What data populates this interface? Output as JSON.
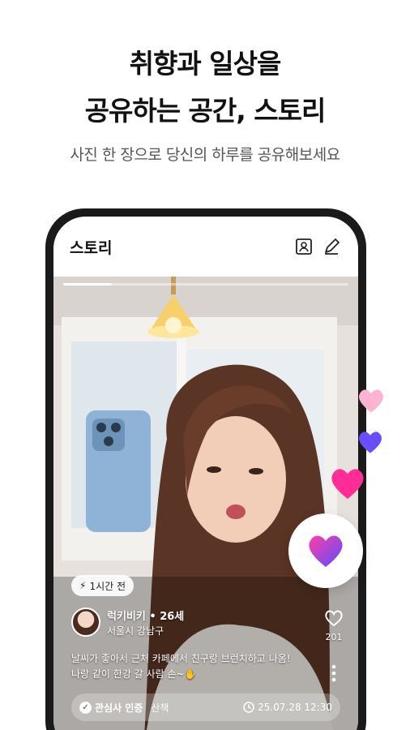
{
  "promo": {
    "headline_line1": "취향과 일상을",
    "headline_line2": "공유하는 공간, 스토리",
    "subtitle": "사진 한 장으로 당신의 하루를 공유해보세요"
  },
  "app": {
    "title": "스토리",
    "icons": [
      "profile-card-icon",
      "edit-pencil-icon"
    ]
  },
  "story": {
    "progress": 0.17,
    "time_ago": "1시간 전",
    "user_name": "럭키비키 • 26세",
    "location": "서울시 강남구",
    "caption_line1": "날씨가 좋아서 근처 카페에서 친구랑 브런치하고 나옴!",
    "caption_line2": "나랑 같이 한강 갈 사람 손~✋",
    "like_count": "201",
    "verified_label": "관심사 인증",
    "interest": "산책",
    "date": "25.07.28 12:30"
  },
  "colors": {
    "accent_heart_start": "#ff3fa4",
    "accent_heart_end": "#5b4bff",
    "pink_heart": "#ff2d95",
    "light_pink_heart": "#ffb3d1",
    "purple_heart": "#6a4dff"
  }
}
